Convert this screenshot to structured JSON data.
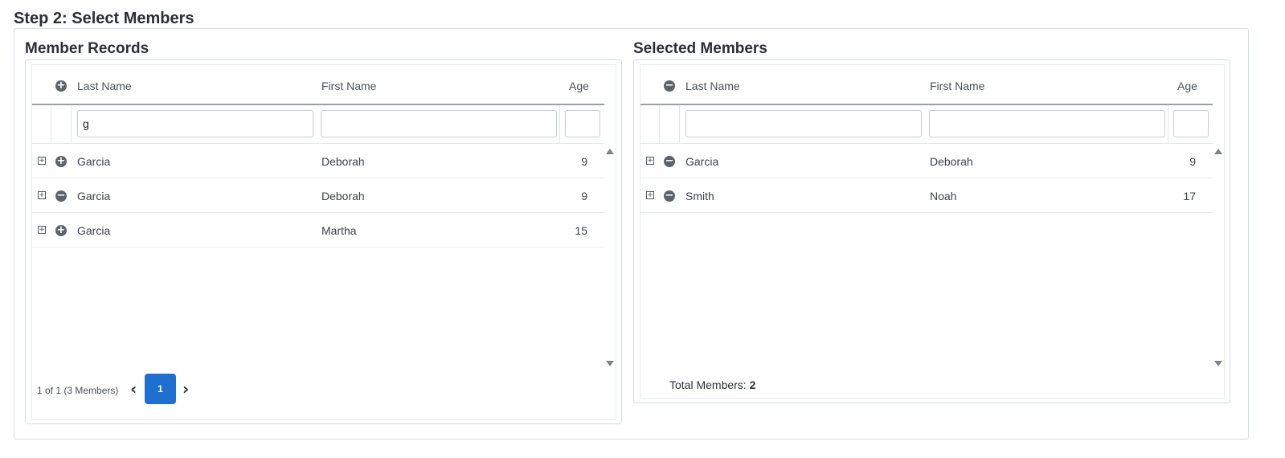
{
  "step_title": "Step 2: Select Members",
  "records": {
    "title": "Member Records",
    "header": {
      "last": "Last Name",
      "first": "First Name",
      "age": "Age"
    },
    "filters": {
      "last": "g",
      "first": "",
      "age": ""
    },
    "rows": [
      {
        "last": "Garcia",
        "first": "Deborah",
        "age": "9",
        "action": "add"
      },
      {
        "last": "Garcia",
        "first": "Deborah",
        "age": "9",
        "action": "remove"
      },
      {
        "last": "Garcia",
        "first": "Martha",
        "age": "15",
        "action": "add"
      }
    ],
    "pager": {
      "info": "1 of 1 (3 Members)",
      "page": "1"
    }
  },
  "selected": {
    "title": "Selected Members",
    "header": {
      "last": "Last Name",
      "first": "First Name",
      "age": "Age"
    },
    "filters": {
      "last": "",
      "first": "",
      "age": ""
    },
    "rows": [
      {
        "last": "Garcia",
        "first": "Deborah",
        "age": "9",
        "action": "remove"
      },
      {
        "last": "Smith",
        "first": "Noah",
        "age": "17",
        "action": "remove"
      }
    ],
    "total_label": "Total Members:",
    "total_value": "2"
  },
  "icons": {
    "add": "plus-circle-icon",
    "remove": "minus-circle-icon",
    "expand": "expand-plus-box-icon"
  },
  "colors": {
    "accent": "#1f6fd1",
    "icon": "#5e636b"
  }
}
